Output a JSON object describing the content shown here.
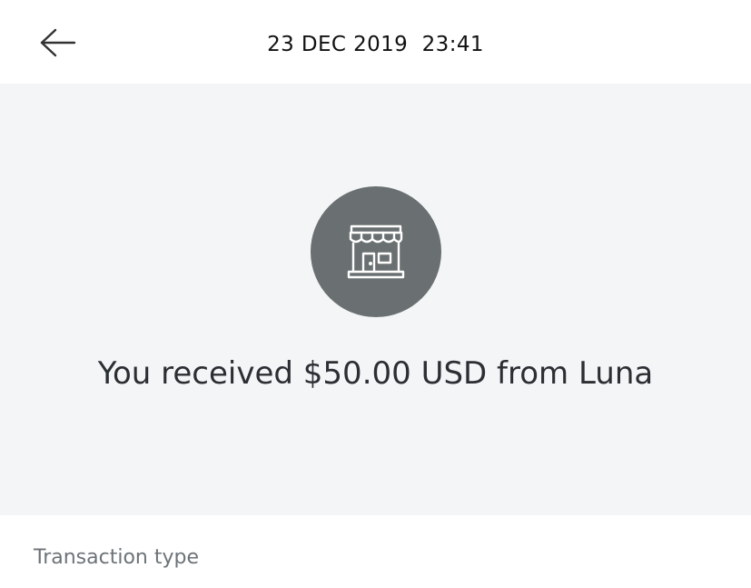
{
  "header": {
    "back_icon": "arrow-left-icon",
    "title": "23 DEC 2019  23:41"
  },
  "hero": {
    "avatar_icon": "storefront-icon",
    "avatar_color": "#6a7071",
    "background_color": "#f4f5f7",
    "summary": "You received $50.00 USD from Luna"
  },
  "details": {
    "transaction_type_label": "Transaction type"
  }
}
